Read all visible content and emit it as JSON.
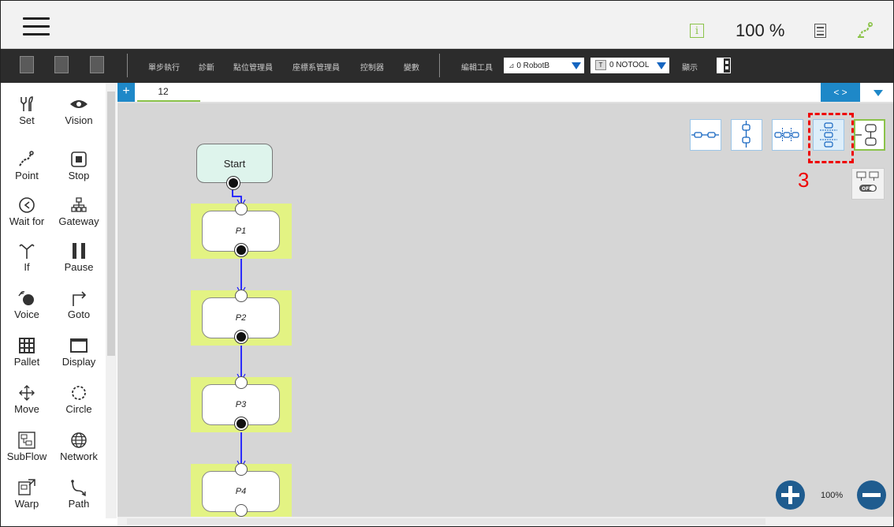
{
  "header": {
    "zoom": "100 %",
    "info_icon": "info-icon",
    "info_glyph": "i"
  },
  "toolbar": {
    "items": [
      "單步執行",
      "診斷",
      "點位管理員",
      "座標系管理員",
      "控制器",
      "變數"
    ],
    "edit_tools": "編輯工具",
    "robot_base_value": "0 RobotB",
    "tool_value": "0 NOTOOL",
    "tool_box_label": "T",
    "display": "顯示"
  },
  "palette": {
    "items": [
      "Set",
      "Vision",
      "Point",
      "Stop",
      "Wait for",
      "Gateway",
      "If",
      "Pause",
      "Voice",
      "Goto",
      "Pallet",
      "Display",
      "Move",
      "Circle",
      "SubFlow",
      "Network",
      "Warp",
      "Path"
    ]
  },
  "tabs": {
    "add_label": "+",
    "current": "12",
    "nav_label": "<  >"
  },
  "flow": {
    "start_label": "Start",
    "nodes": [
      "P1",
      "P2",
      "P3",
      "P4"
    ]
  },
  "annotation": {
    "callout": "3"
  },
  "canvas": {
    "zoom": "100%",
    "toggle_label": "OFF"
  },
  "colors": {
    "accent_blue": "#1e88c8",
    "node_highlight": "#e3f383",
    "start_fill": "#def4ec",
    "annotation_red": "#e00000",
    "green": "#8bc34a"
  }
}
